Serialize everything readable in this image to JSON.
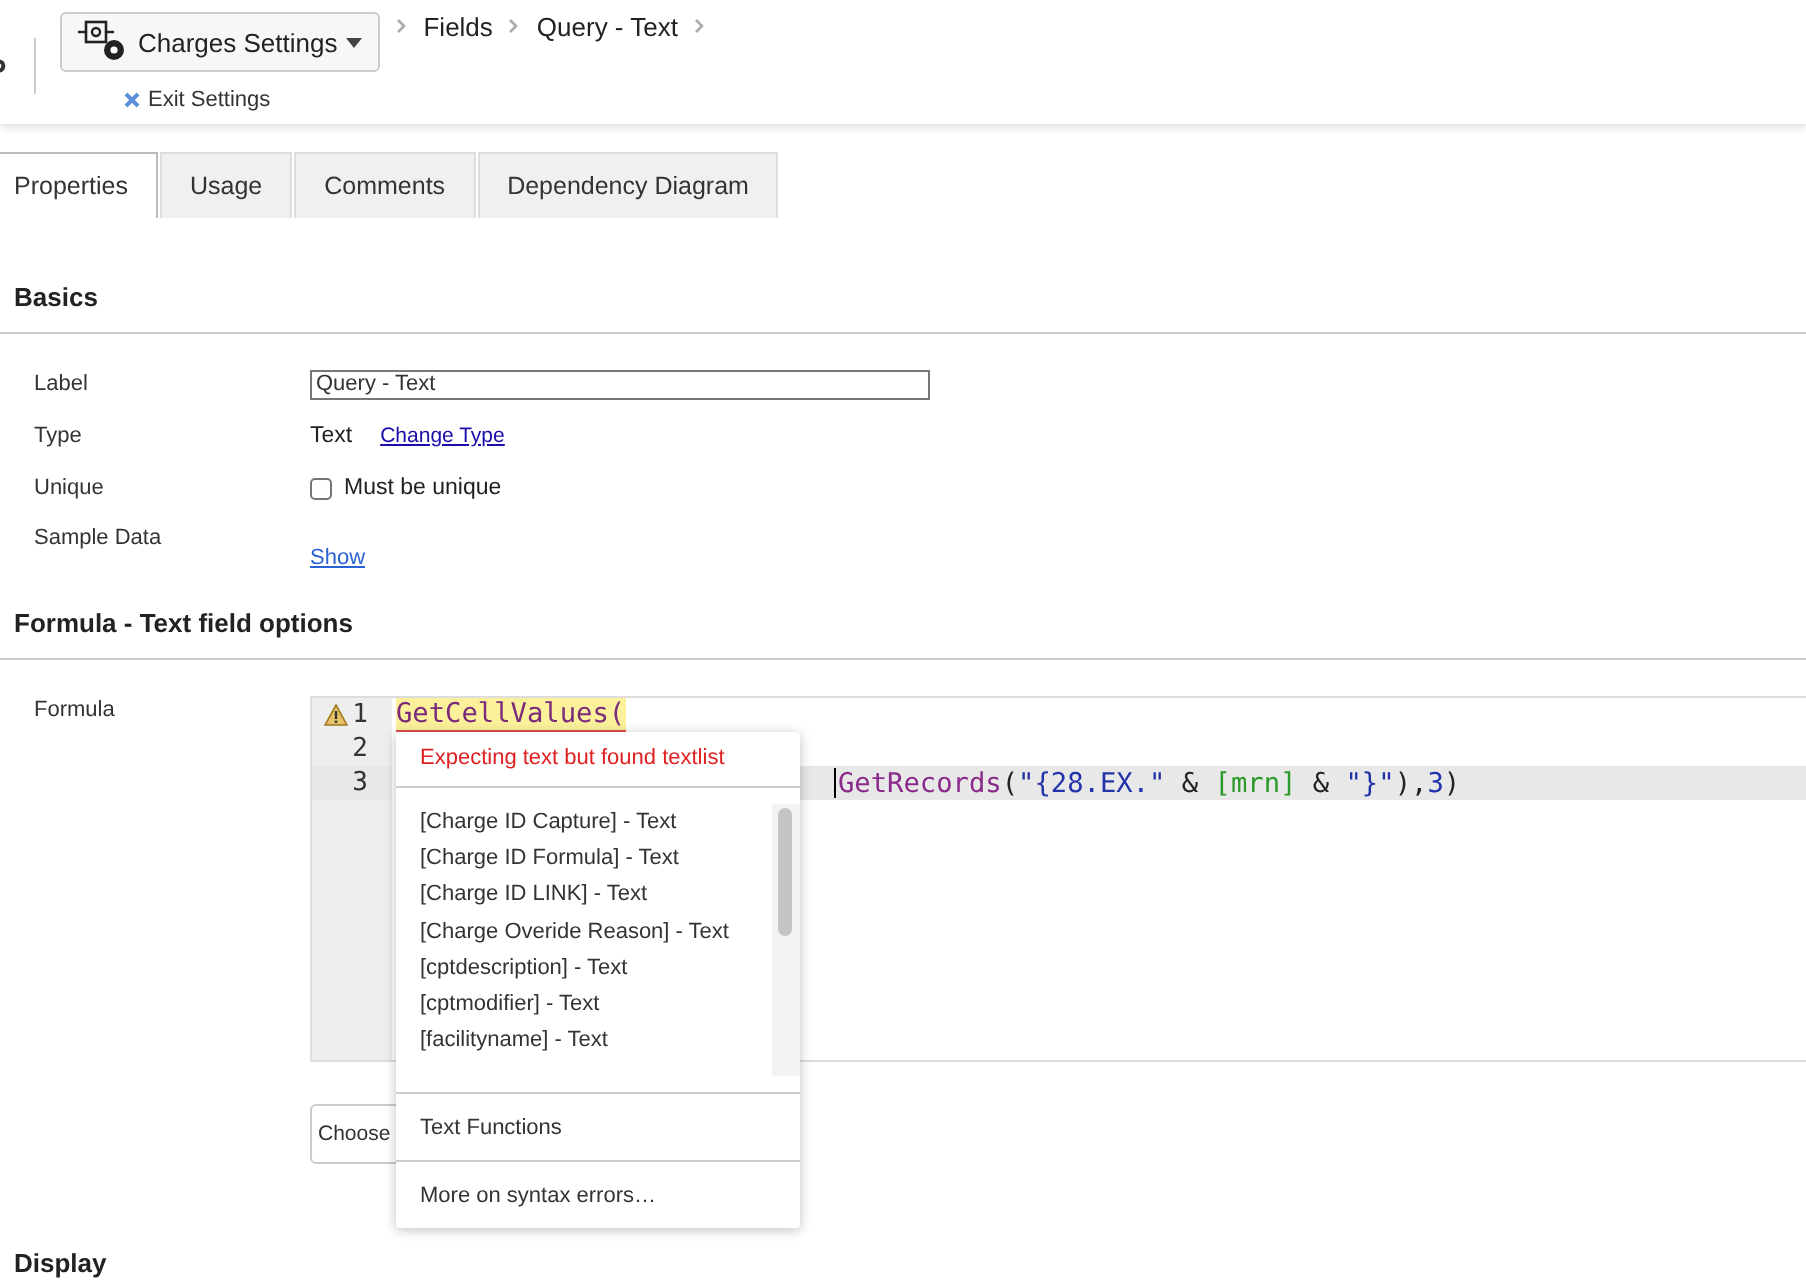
{
  "header": {
    "app_button": {
      "label": "Charges Settings"
    },
    "breadcrumb": [
      "Fields",
      "Query - Text"
    ],
    "exit_link": "Exit Settings"
  },
  "tabs": [
    {
      "label": "Properties",
      "selected": true
    },
    {
      "label": "Usage",
      "selected": false
    },
    {
      "label": "Comments",
      "selected": false
    },
    {
      "label": "Dependency Diagram",
      "selected": false
    }
  ],
  "basics": {
    "title": "Basics",
    "label_row": {
      "label": "Label",
      "value": "Query - Text"
    },
    "type_row": {
      "label": "Type",
      "value": "Text",
      "link": "Change Type"
    },
    "unique_row": {
      "label": "Unique",
      "checkbox_label": "Must be unique",
      "checked": false
    },
    "sample_row": {
      "label": "Sample Data",
      "link": "Show"
    }
  },
  "formula_section": {
    "title": "Formula - Text field options",
    "label": "Formula",
    "lines": [
      {
        "number": "1",
        "warning": true,
        "current": false,
        "indented": false,
        "tokens": [
          {
            "kind": "error",
            "text": "GetCellValues("
          }
        ]
      },
      {
        "number": "2",
        "warning": false,
        "current": false
      },
      {
        "number": "3",
        "warning": false,
        "current": true,
        "indented": true,
        "tokens": [
          {
            "kind": "function",
            "text": "GetRecords"
          },
          {
            "kind": "plain",
            "text": "("
          },
          {
            "kind": "string",
            "text": "\"{28.EX.\""
          },
          {
            "kind": "plain",
            "text": " & "
          },
          {
            "kind": "field",
            "text": "[mrn]"
          },
          {
            "kind": "plain",
            "text": " & "
          },
          {
            "kind": "string",
            "text": "\"}\""
          },
          {
            "kind": "plain",
            "text": "),"
          },
          {
            "kind": "number",
            "text": "3"
          },
          {
            "kind": "plain",
            "text": ")"
          }
        ]
      }
    ],
    "choose_button": "Choose",
    "popup": {
      "error": "Expecting text but found textlist",
      "items": [
        "[Charge ID Capture] - Text",
        "[Charge ID Formula] - Text",
        "[Charge ID LINK] - Text",
        "[Charge Overide Reason] - Text",
        "[cptdescription] - Text",
        "[cptmodifier] - Text",
        "[facilityname] - Text"
      ],
      "functions": "Text Functions",
      "help": "More on syntax errors…"
    }
  },
  "display": {
    "title": "Display"
  }
}
